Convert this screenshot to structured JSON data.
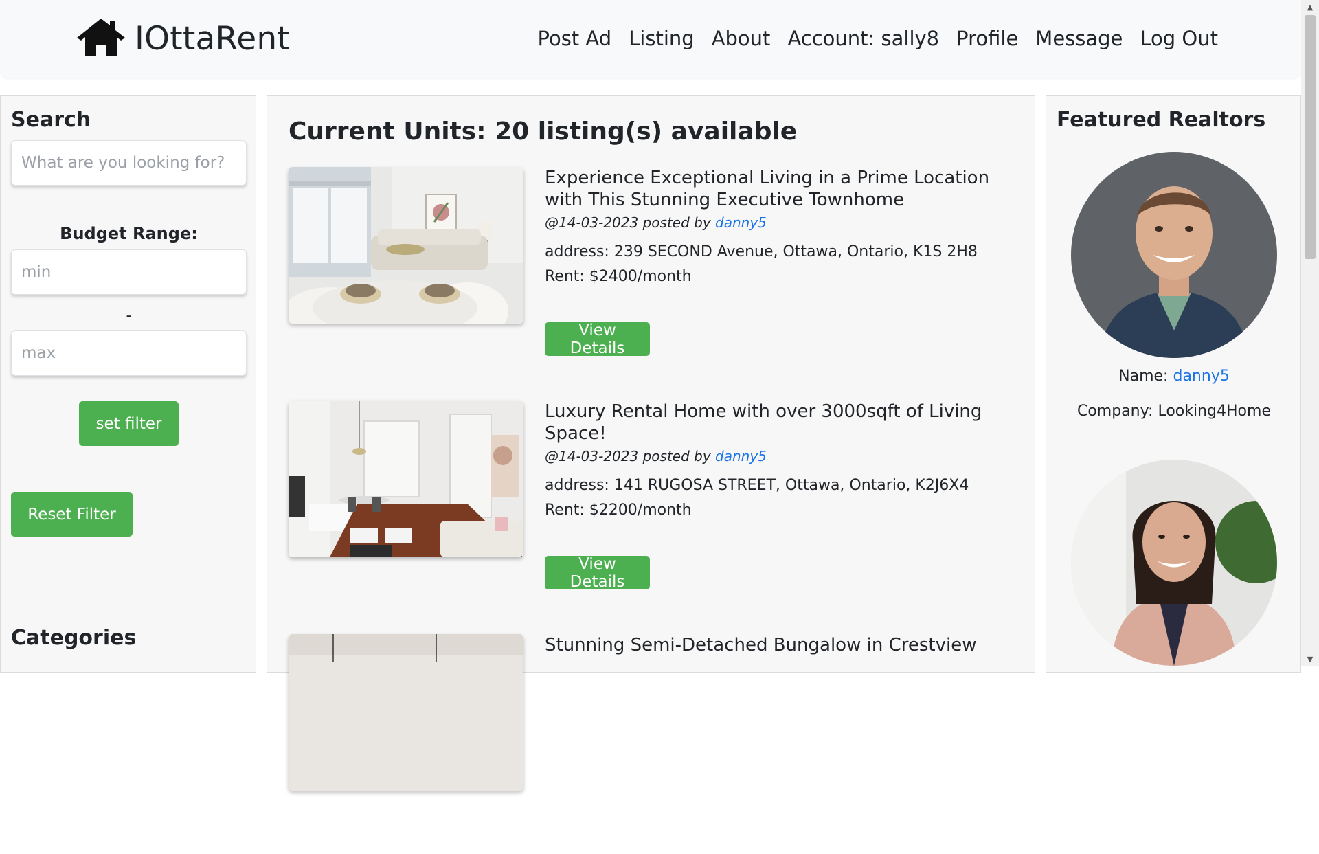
{
  "brand": {
    "name": "IOttaRent",
    "icon": "house-icon"
  },
  "nav": {
    "items": [
      {
        "label": "Post Ad"
      },
      {
        "label": "Listing"
      },
      {
        "label": "About"
      },
      {
        "label": "Account: sally8"
      },
      {
        "label": "Profile"
      },
      {
        "label": "Message"
      },
      {
        "label": "Log Out"
      }
    ]
  },
  "search": {
    "title": "Search",
    "placeholder": "What are you looking for?",
    "budget_label": "Budget Range:",
    "min_placeholder": "min",
    "separator": "-",
    "max_placeholder": "max",
    "set_filter_label": "set filter",
    "reset_filter_label": "Reset Filter",
    "categories_title": "Categories"
  },
  "main": {
    "title": "Current Units: 20 listing(s) available",
    "listings": [
      {
        "title": "Experience Exceptional Living in a Prime Location with This Stunning Executive Townhome",
        "posted_prefix": "@14-03-2023 posted by",
        "poster": "danny5",
        "address": "address: 239 SECOND Avenue, Ottawa, Ontario, K1S 2H8",
        "rent": "Rent: $2400/month",
        "button": "View Details"
      },
      {
        "title": "Luxury Rental Home with over 3000sqft of Living Space!",
        "posted_prefix": "@14-03-2023 posted by",
        "poster": "danny5",
        "address": "address: 141 RUGOSA STREET, Ottawa, Ontario, K2J6X4",
        "rent": "Rent: $2200/month",
        "button": "View Details"
      },
      {
        "title": "Stunning Semi-Detached Bungalow in Crestview"
      }
    ]
  },
  "realtors": {
    "title": "Featured Realtors",
    "name_prefix": "Name:",
    "company_prefix": "Company:",
    "items": [
      {
        "name": "danny5",
        "company": "Looking4Home"
      },
      {}
    ]
  },
  "colors": {
    "accent_green": "#4caf50",
    "link_blue": "#1a73e8",
    "navbar_bg": "#f8f9fa",
    "panel_bg": "#f7f7f7"
  }
}
